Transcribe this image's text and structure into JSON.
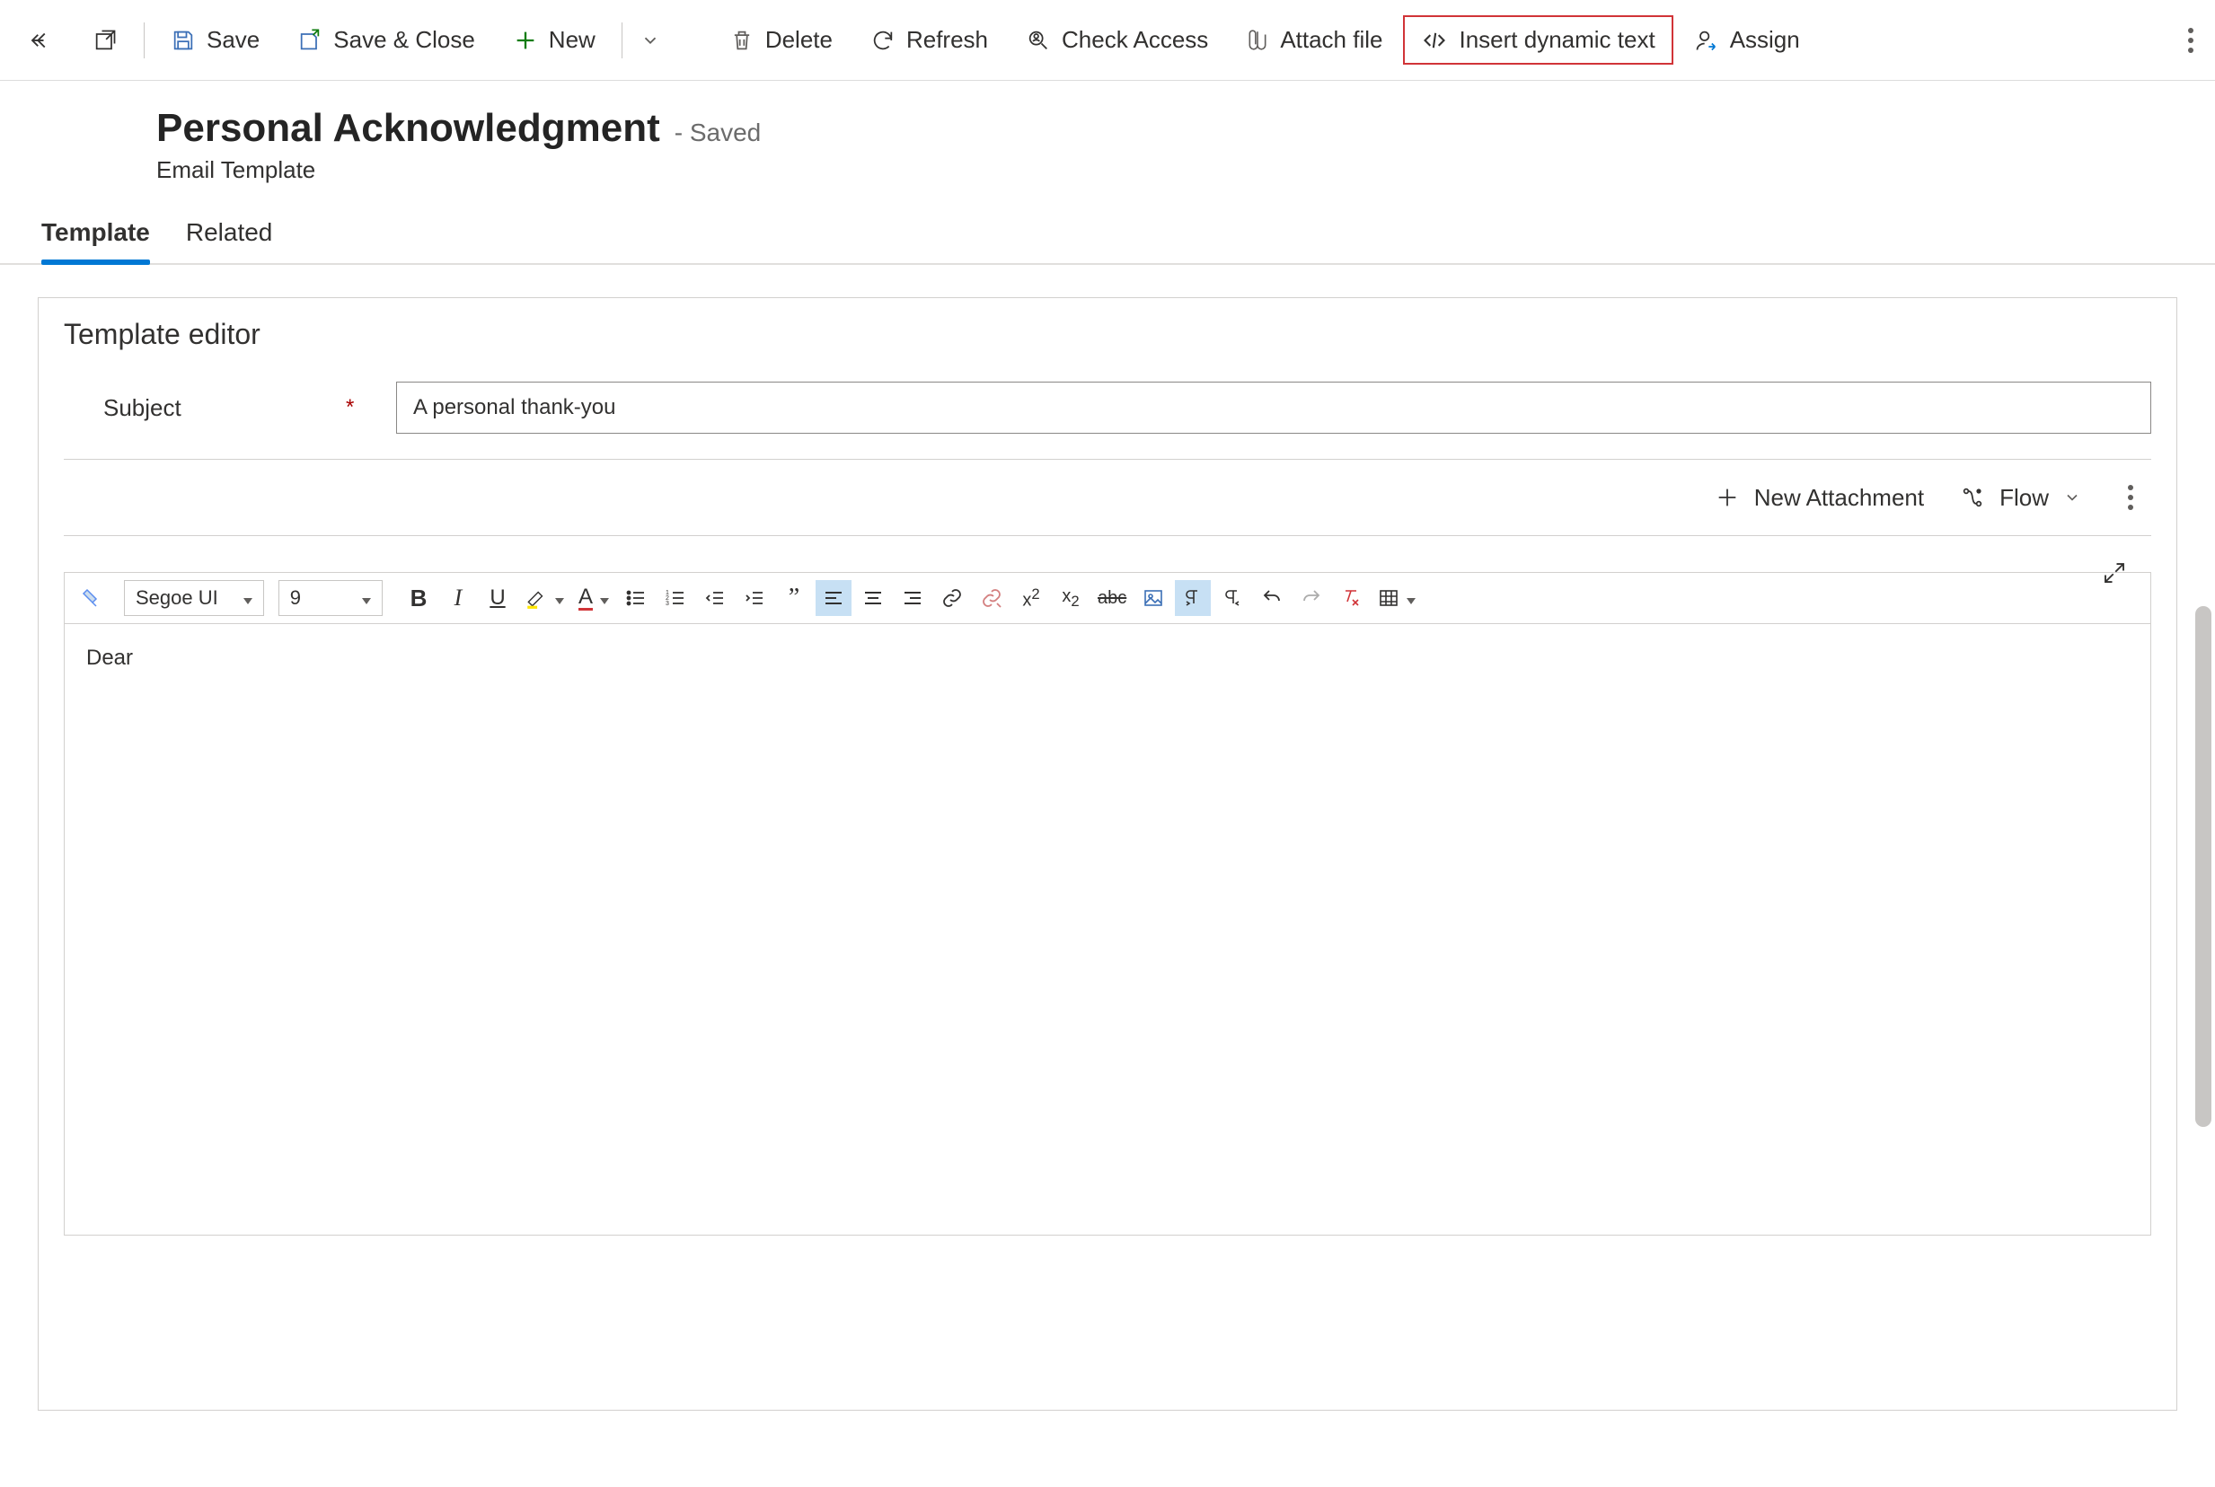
{
  "commandBar": {
    "save": "Save",
    "saveClose": "Save & Close",
    "new": "New",
    "delete": "Delete",
    "refresh": "Refresh",
    "checkAccess": "Check Access",
    "attachFile": "Attach file",
    "insertDynamic": "Insert dynamic text",
    "assign": "Assign"
  },
  "header": {
    "title": "Personal Acknowledgment",
    "status": "- Saved",
    "subtitle": "Email Template"
  },
  "tabs": {
    "template": "Template",
    "related": "Related"
  },
  "editor": {
    "sectionTitle": "Template editor",
    "subjectLabel": "Subject",
    "subjectValue": "A personal thank-you",
    "newAttachment": "New Attachment",
    "flow": "Flow",
    "fontName": "Segoe UI",
    "fontSize": "9",
    "body": "Dear"
  }
}
